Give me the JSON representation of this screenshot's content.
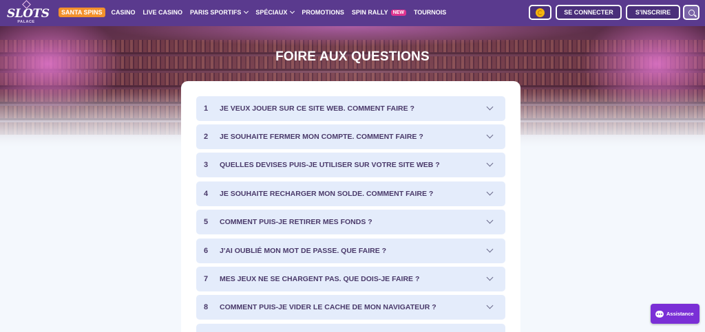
{
  "brand": {
    "name": "SLOTS",
    "sub": "PALACE"
  },
  "nav": {
    "santa": "SANTA SPINS",
    "casino": "CASINO",
    "live_casino": "LIVE CASINO",
    "paris_sportifs": "PARIS SPORTIFS",
    "speciaux": "SPÉCIAUX",
    "promotions": "PROMOTIONS",
    "spin_rally": "SPIN RALLY",
    "new_badge": "NEW",
    "tournois": "TOURNOIS"
  },
  "header_actions": {
    "login": "SE CONNECTER",
    "register": "S'INSCRIRE"
  },
  "page": {
    "title": "FOIRE AUX QUESTIONS"
  },
  "faq": [
    {
      "num": "1",
      "question": "JE VEUX JOUER SUR CE SITE WEB. COMMENT FAIRE ?"
    },
    {
      "num": "2",
      "question": "JE SOUHAITE FERMER MON COMPTE. COMMENT FAIRE ?"
    },
    {
      "num": "3",
      "question": "QUELLES DEVISES PUIS-JE UTILISER SUR VOTRE SITE WEB ?"
    },
    {
      "num": "4",
      "question": "JE SOUHAITE RECHARGER MON SOLDE. COMMENT FAIRE ?"
    },
    {
      "num": "5",
      "question": "COMMENT PUIS-JE RETIRER MES FONDS ?"
    },
    {
      "num": "6",
      "question": "J'AI OUBLIÉ MON MOT DE PASSE. QUE FAIRE ?"
    },
    {
      "num": "7",
      "question": "MES JEUX NE SE CHARGENT PAS. QUE DOIS-JE FAIRE ?"
    },
    {
      "num": "8",
      "question": "COMMENT PUIS-JE VIDER LE CACHE DE MON NAVIGATEUR ?"
    }
  ],
  "assistance": {
    "label": "Assistance"
  },
  "colors": {
    "header_bg": "#5a3a8e",
    "santa_badge": "#f3912c",
    "new_badge": "#e0348f",
    "faq_item_bg": "#e4ecfb",
    "faq_text": "#4a3a6a",
    "assist_bg": "#7a2fd6"
  }
}
